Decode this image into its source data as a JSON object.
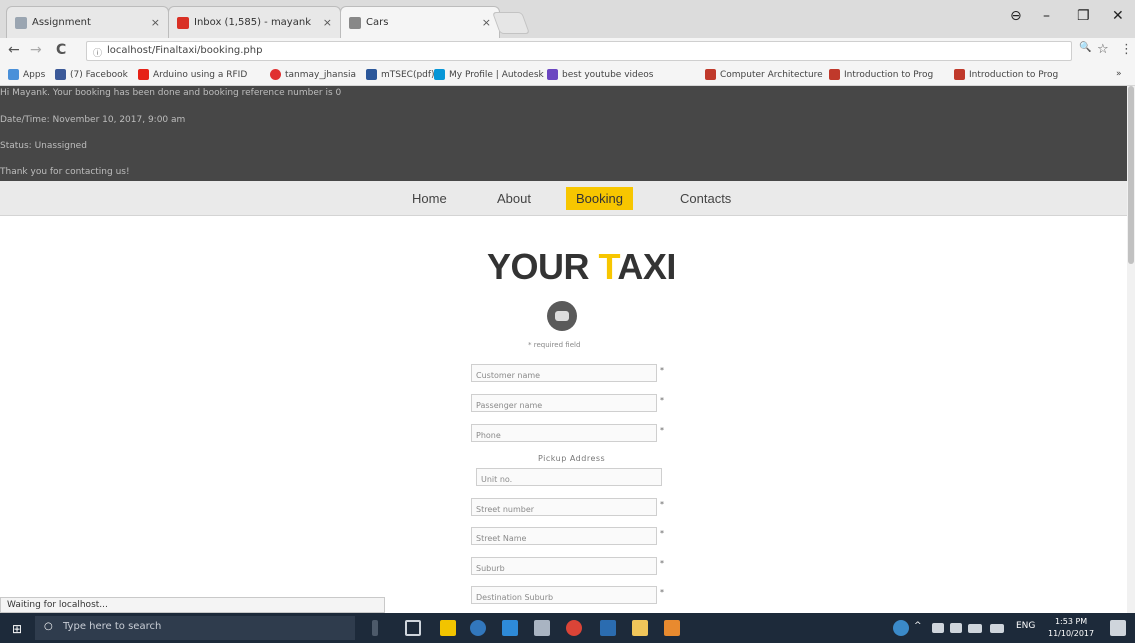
{
  "browser": {
    "tabs": [
      {
        "title": "Assignment",
        "close": "×",
        "favicon_color": "#9aa5b1"
      },
      {
        "title": "Inbox (1,585) - mayank",
        "close": "×",
        "favicon_color": "#d93025"
      },
      {
        "title": "Cars",
        "close": "×",
        "favicon_color": "#888888"
      }
    ],
    "window_controls": {
      "user": "⊖",
      "minimize": "–",
      "maximize": "❐",
      "close": "✕"
    },
    "nav": {
      "back": "←",
      "forward": "→",
      "reload": "C"
    },
    "url": "localhost/Finaltaxi/booking.php",
    "url_icon": "ⓘ",
    "zoom_icon": "🔍",
    "star_icon": "☆",
    "menu_icon": "⋮",
    "bookmarks": [
      {
        "label": "Apps",
        "color": "#4a90d9"
      },
      {
        "label": "(7) Facebook",
        "color": "#3b5998"
      },
      {
        "label": "Arduino using a RFID",
        "color": "#e62117"
      },
      {
        "label": "tanmay_jhansia",
        "color": "#e03030"
      },
      {
        "label": "mTSEC(pdf)",
        "color": "#2b579a"
      },
      {
        "label": "My Profile | Autodesk",
        "color": "#0696d7"
      },
      {
        "label": "best youtube videos",
        "color": "#6b46c1"
      },
      {
        "label": "Computer Architecture",
        "color": "#c0392b"
      },
      {
        "label": "Introduction to Prog",
        "color": "#c0392b"
      },
      {
        "label": "Introduction to Prog",
        "color": "#c0392b"
      }
    ],
    "bookmarks_more": "»"
  },
  "page": {
    "messages": [
      "Hi Mayank. Your booking has been done and booking reference number is 0",
      "Date/Time: November 10, 2017, 9:00 am",
      "Status: Unassigned",
      "Thank you for contacting us!"
    ],
    "nav_links": [
      "Home",
      "About",
      "Booking",
      "Contacts"
    ],
    "active_nav": "Booking",
    "brand": {
      "part1": "YOUR ",
      "accent": "T",
      "part2": "AXI"
    },
    "accent_color": "#f7c600",
    "required_note": "* required field",
    "pickup_label": "Pickup Address",
    "fields": [
      {
        "placeholder": "Customer name",
        "required": "*"
      },
      {
        "placeholder": "Passenger name",
        "required": "*"
      },
      {
        "placeholder": "Phone",
        "required": "*"
      },
      {
        "placeholder": "Unit no.",
        "required": ""
      },
      {
        "placeholder": "Street number",
        "required": "*"
      },
      {
        "placeholder": "Street Name",
        "required": "*"
      },
      {
        "placeholder": "Suburb",
        "required": "*"
      },
      {
        "placeholder": "Destination Suburb",
        "required": "*"
      }
    ]
  },
  "status_text": "Waiting for localhost...",
  "taskbar": {
    "start_icon": "⊞",
    "search_placeholder": "Type here to search",
    "search_icon": "○",
    "tray_text": "ENG",
    "time": "1:53 PM",
    "date": "11/10/2017",
    "chevron": "^"
  }
}
